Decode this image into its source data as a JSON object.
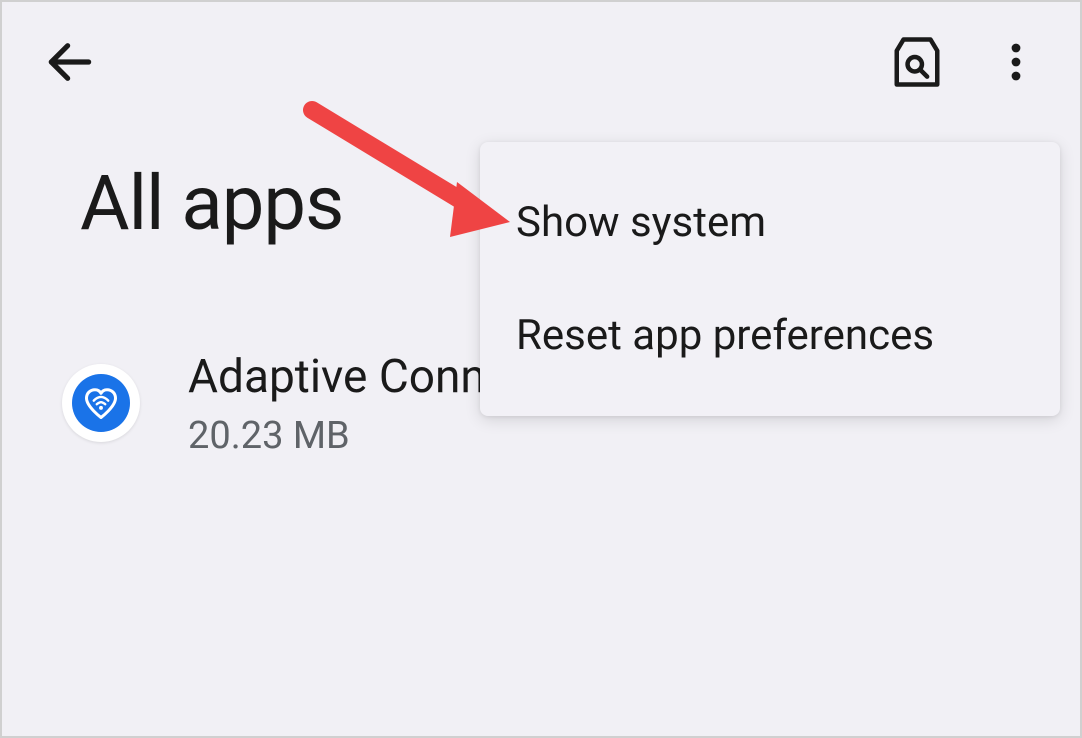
{
  "page": {
    "title": "All apps"
  },
  "menu": {
    "items": [
      {
        "label": "Show system"
      },
      {
        "label": "Reset app preferences"
      }
    ]
  },
  "apps": [
    {
      "name": "Adaptive Connectivity Services",
      "size": "20.23 MB",
      "icon": "heart-wifi-icon"
    }
  ]
}
